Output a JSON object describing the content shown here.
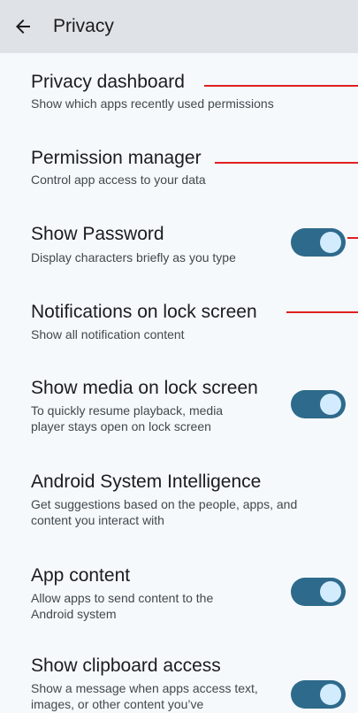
{
  "header": {
    "title": "Privacy",
    "back_icon": "arrow-left-icon"
  },
  "settings": [
    {
      "title": "Privacy dashboard",
      "summary": "Show which apps recently used permissions",
      "toggle": null
    },
    {
      "title": "Permission manager",
      "summary": "Control app access to your data",
      "toggle": null
    },
    {
      "title": "Show Password",
      "summary": "Display characters briefly as you type",
      "toggle": true
    },
    {
      "title": "Notifications on lock screen",
      "summary": "Show all notification content",
      "toggle": null
    },
    {
      "title": "Show media on lock screen",
      "summary": "To quickly resume playback, media player stays open on lock screen",
      "toggle": true
    },
    {
      "title": "Android System Intelligence",
      "summary": "Get suggestions based on the people, apps, and content you interact with",
      "toggle": null
    },
    {
      "title": "App content",
      "summary": "Allow apps to send content to the Android system",
      "toggle": true
    },
    {
      "title": "Show clipboard access",
      "summary": "Show a message when apps access text, images, or other content you’ve",
      "toggle": true
    }
  ],
  "colors": {
    "header_bg": "#dfe3e7",
    "background": "#f5f9fc",
    "switch_track_on": "#2e6a8b",
    "switch_thumb_on": "#d2ecfd",
    "annotation_line": "#e02020"
  }
}
